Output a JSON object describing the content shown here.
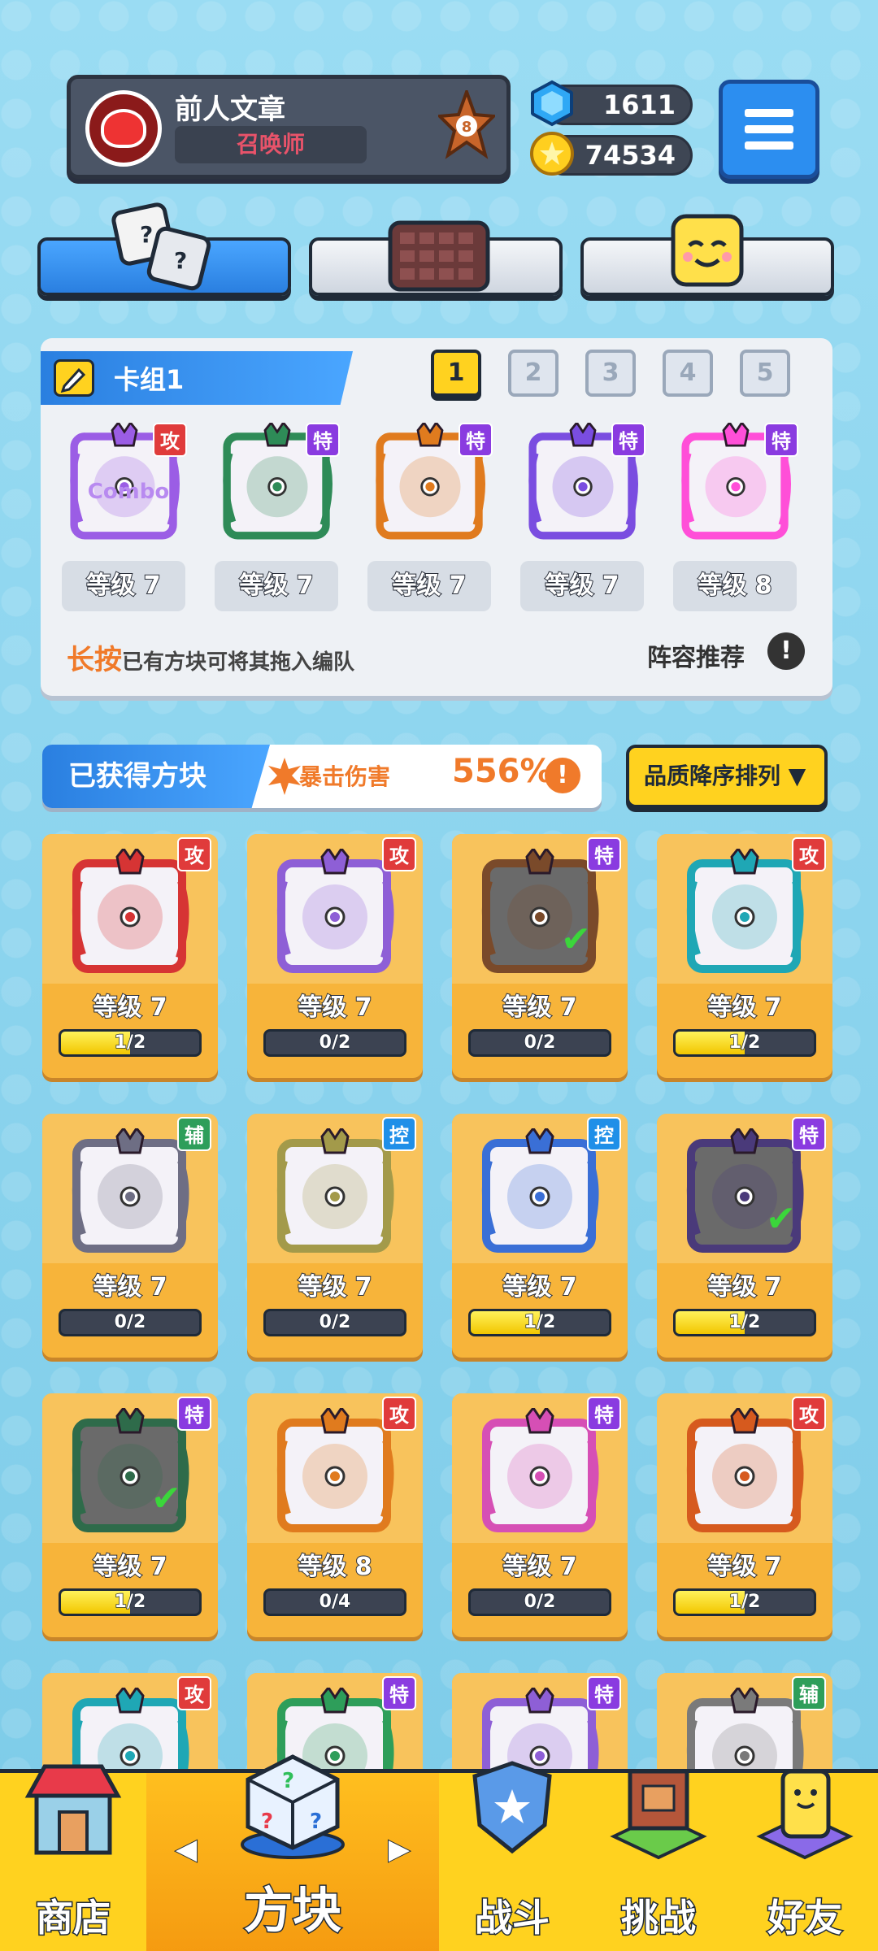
{
  "header": {
    "player_name": "前人文章",
    "player_title": "召唤师",
    "rank": "8",
    "gems": "1611",
    "coins": "74534"
  },
  "tabs": [
    {
      "name": "dice"
    },
    {
      "name": "board"
    },
    {
      "name": "emoji"
    }
  ],
  "deck": {
    "title": "卡组1",
    "pages": [
      "1",
      "2",
      "3",
      "4",
      "5"
    ],
    "selected_page": "1",
    "cards": [
      {
        "tag": "攻",
        "level": "等级 7",
        "tag_color": "#e03b3b",
        "color": "#9b5de5",
        "label": "Combo"
      },
      {
        "tag": "特",
        "level": "等级 7",
        "tag_color": "#8a3be0",
        "color": "#2e8b57",
        "label": ""
      },
      {
        "tag": "特",
        "level": "等级 7",
        "tag_color": "#8a3be0",
        "color": "#e07b1e",
        "label": ""
      },
      {
        "tag": "特",
        "level": "等级 7",
        "tag_color": "#8a3be0",
        "color": "#7a4de0",
        "label": ""
      },
      {
        "tag": "特",
        "level": "等级 8",
        "tag_color": "#8a3be0",
        "color": "#ff4fd8",
        "label": ""
      }
    ],
    "hint_strong": "长按",
    "hint_text": "已有方块可将其拖入编队",
    "recommend": "阵容推荐",
    "recommend_icon": "!"
  },
  "owned": {
    "title": "已获得方块",
    "crit_label": "暴击伤害",
    "crit_value": "556%",
    "sort_label": "品质降序排列 ▼",
    "cards": [
      {
        "tag": "攻",
        "tag_color": "#e03b3b",
        "level": "等级 7",
        "progress": "1/2",
        "fill": 0.5,
        "color": "#d63434",
        "checked": false
      },
      {
        "tag": "攻",
        "tag_color": "#e03b3b",
        "level": "等级 7",
        "progress": "0/2",
        "fill": 0,
        "color": "#8e5fd6",
        "checked": false
      },
      {
        "tag": "特",
        "tag_color": "#8a3be0",
        "level": "等级 7",
        "progress": "0/2",
        "fill": 0,
        "color": "#7a4a2a",
        "checked": true
      },
      {
        "tag": "攻",
        "tag_color": "#e03b3b",
        "level": "等级 7",
        "progress": "1/2",
        "fill": 0.5,
        "color": "#1fa7b5",
        "checked": false
      },
      {
        "tag": "辅",
        "tag_color": "#2e9e5a",
        "level": "等级 7",
        "progress": "0/2",
        "fill": 0,
        "color": "#6e6e84",
        "checked": false
      },
      {
        "tag": "控",
        "tag_color": "#1f8fe8",
        "level": "等级 7",
        "progress": "0/2",
        "fill": 0,
        "color": "#a39a4a",
        "checked": false
      },
      {
        "tag": "控",
        "tag_color": "#1f8fe8",
        "level": "等级 7",
        "progress": "1/2",
        "fill": 0.5,
        "color": "#3a6fd6",
        "checked": false
      },
      {
        "tag": "特",
        "tag_color": "#8a3be0",
        "level": "等级 7",
        "progress": "1/2",
        "fill": 0.5,
        "color": "#4a3a7a",
        "checked": true
      },
      {
        "tag": "特",
        "tag_color": "#8a3be0",
        "level": "等级 7",
        "progress": "1/2",
        "fill": 0.5,
        "color": "#2e6b4a",
        "checked": true
      },
      {
        "tag": "攻",
        "tag_color": "#e03b3b",
        "level": "等级 8",
        "progress": "0/4",
        "fill": 0,
        "color": "#e07b1e",
        "checked": false
      },
      {
        "tag": "特",
        "tag_color": "#8a3be0",
        "level": "等级 7",
        "progress": "0/2",
        "fill": 0,
        "color": "#d64fb5",
        "checked": false
      },
      {
        "tag": "攻",
        "tag_color": "#e03b3b",
        "level": "等级 7",
        "progress": "1/2",
        "fill": 0.5,
        "color": "#d65a1e",
        "checked": false
      },
      {
        "tag": "攻",
        "tag_color": "#e03b3b",
        "level": "",
        "progress": "",
        "fill": 0,
        "color": "#1fa7b5",
        "checked": false
      },
      {
        "tag": "特",
        "tag_color": "#8a3be0",
        "level": "",
        "progress": "",
        "fill": 0,
        "color": "#2e9e5a",
        "checked": false
      },
      {
        "tag": "特",
        "tag_color": "#8a3be0",
        "level": "",
        "progress": "",
        "fill": 0,
        "color": "#8e5fd6",
        "checked": false
      },
      {
        "tag": "辅",
        "tag_color": "#2e9e5a",
        "level": "",
        "progress": "",
        "fill": 0,
        "color": "#7a7a7a",
        "checked": false
      }
    ]
  },
  "nav": {
    "shop": "商店",
    "blocks": "方块",
    "battle": "战斗",
    "challenge": "挑战",
    "friends": "好友",
    "left_arrow": "◀",
    "right_arrow": "▶"
  }
}
